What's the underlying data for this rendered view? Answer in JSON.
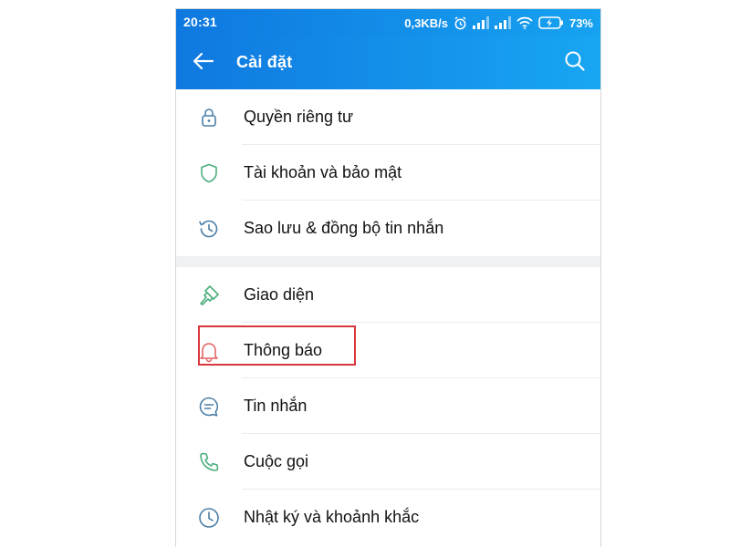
{
  "status_bar": {
    "time": "20:31",
    "network_speed": "0,3KB/s",
    "battery": "73%"
  },
  "app_bar": {
    "title": "Cài đặt",
    "back_icon": "arrow-left-icon",
    "search_icon": "search-icon"
  },
  "settings": {
    "group1": [
      {
        "label": "Quyền riêng tư",
        "icon": "lock-icon"
      },
      {
        "label": "Tài khoản và bảo mật",
        "icon": "shield-icon"
      },
      {
        "label": "Sao lưu & đồng bộ tin nhắn",
        "icon": "history-icon"
      }
    ],
    "group2": [
      {
        "label": "Giao diện",
        "icon": "paint-brush-icon"
      },
      {
        "label": "Thông báo",
        "icon": "bell-icon",
        "highlighted": true
      },
      {
        "label": "Tin nhắn",
        "icon": "chat-bubble-icon"
      },
      {
        "label": "Cuộc gọi",
        "icon": "phone-icon"
      },
      {
        "label": "Nhật ký và khoảnh khắc",
        "icon": "clock-icon"
      }
    ]
  },
  "colors": {
    "app_bar_start": "#0f78e0",
    "app_bar_end": "#18a6f2",
    "highlight": "#d9373d",
    "icon_blue": "#4a7fa8",
    "icon_green": "#4cae7d",
    "icon_red": "#e25d5d"
  }
}
